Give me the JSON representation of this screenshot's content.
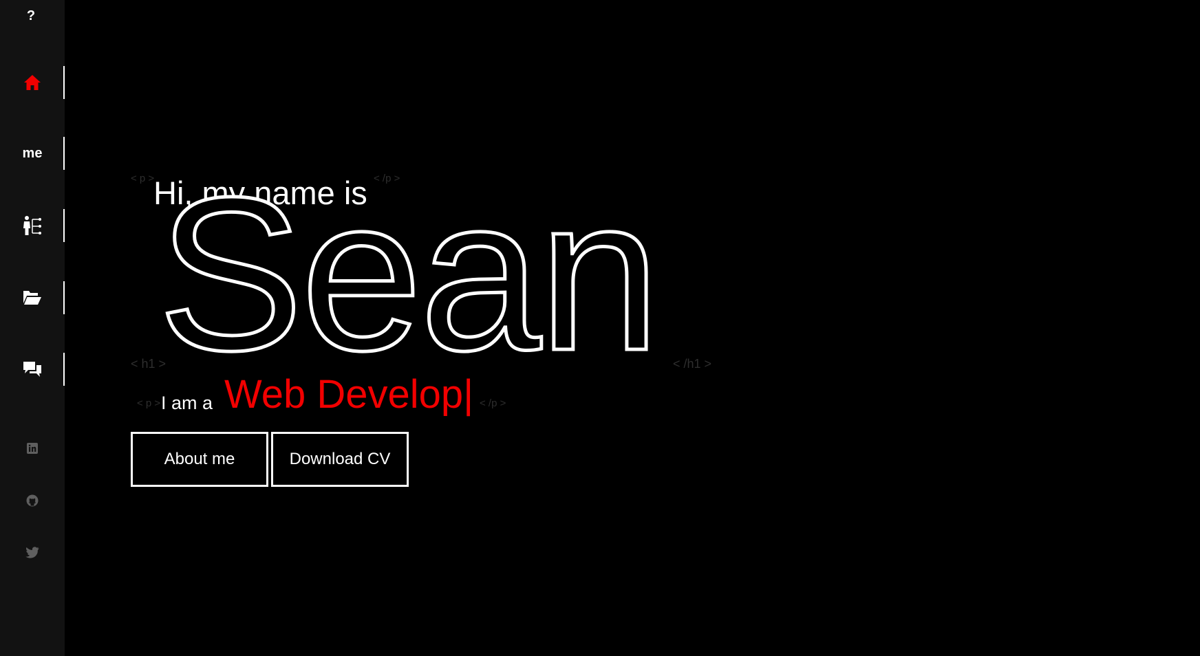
{
  "sidebar": {
    "logo": "?",
    "nav": [
      {
        "id": "home",
        "icon": "home-icon",
        "active": true
      },
      {
        "id": "about",
        "label": "me"
      },
      {
        "id": "skills",
        "icon": "org-chart-icon"
      },
      {
        "id": "projects",
        "icon": "folder-open-icon"
      },
      {
        "id": "contact",
        "icon": "chat-bubbles-icon"
      }
    ],
    "social": [
      {
        "id": "linkedin",
        "icon": "linkedin-icon"
      },
      {
        "id": "github",
        "icon": "github-icon"
      },
      {
        "id": "twitter",
        "icon": "twitter-icon"
      }
    ]
  },
  "hero": {
    "tags": {
      "p_open_top": "< p >",
      "p_close_top": "< /p >",
      "h1_open": "< h1 >",
      "h1_close": "< /h1 >",
      "p_open_bottom": "< p >",
      "p_close_bottom": "< /p >"
    },
    "greeting": "Hi, my name is",
    "name": "Sean",
    "role_prefix": "I am a",
    "role_typed": "Web Develop|"
  },
  "buttons": {
    "about": "About me",
    "cv": "Download CV"
  },
  "colors": {
    "accent": "#f20000",
    "background": "#000000",
    "sidebar": "#121212",
    "text": "#ffffff",
    "tag": "#2e2e2e",
    "social_icon": "#5f5f5f"
  }
}
